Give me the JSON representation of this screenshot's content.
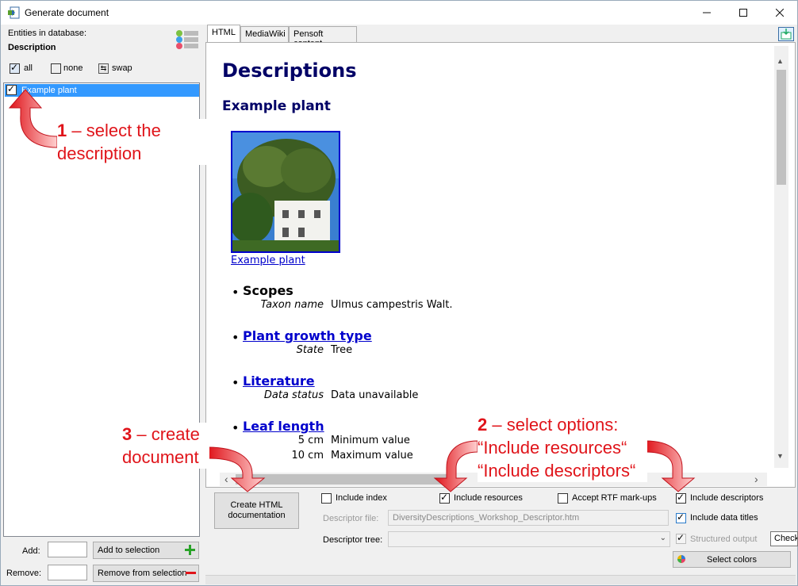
{
  "window": {
    "title": "Generate document"
  },
  "left": {
    "entities_label": "Entities in database:",
    "entity_type": "Description",
    "all_label": "all",
    "none_label": "none",
    "swap_label": "swap",
    "list_items": [
      "Example plant"
    ],
    "add_label": "Add:",
    "remove_label": "Remove:",
    "add_button": "Add to selection",
    "remove_button": "Remove from selection"
  },
  "tabs": [
    "HTML",
    "MediaWiki",
    "Pensoft content"
  ],
  "doc": {
    "h1": "Descriptions",
    "h2": "Example plant",
    "image_caption": "Example plant",
    "items": [
      {
        "title": "Scopes",
        "link": false,
        "rows": [
          [
            "Taxon name",
            "Ulmus campestris Walt."
          ]
        ]
      },
      {
        "title": "Plant growth type",
        "link": true,
        "rows": [
          [
            "State",
            "Tree"
          ]
        ]
      },
      {
        "title": "Literature",
        "link": true,
        "rows": [
          [
            "Data status",
            "Data unavailable"
          ]
        ]
      },
      {
        "title": "Leaf length",
        "link": true,
        "rows": [
          [
            "5 cm",
            "Minimum value"
          ],
          [
            "10 cm",
            "Maximum value"
          ]
        ]
      }
    ]
  },
  "bottom": {
    "create_button": "Create HTML documentation",
    "include_index": "Include index",
    "include_resources": "Include resources",
    "accept_rtf": "Accept RTF mark-ups",
    "include_descriptors": "Include descriptors",
    "include_data_titles": "Include data titles",
    "structured_output": "Structured output",
    "descriptor_file_label": "Descriptor file:",
    "descriptor_file_value": "DiversityDescriptions_Workshop_Descriptor.htm",
    "descriptor_tree_label": "Descriptor tree:",
    "select_colors": "Select colors",
    "tooltip": "Check"
  },
  "annotations": {
    "a1_num": "1",
    "a1_line1": " – select the",
    "a1_line2": "description",
    "a2_num": "2",
    "a2_line1": " – select options:",
    "a2_line2": "“Include resources“",
    "a2_line3": "“Include descriptors“",
    "a3_num": "3",
    "a3_line1": " – create",
    "a3_line2": "document"
  },
  "colors": {
    "selection": "#3399ff",
    "heading": "#000066",
    "link": "#0000cc",
    "annotation": "#e0141a"
  }
}
